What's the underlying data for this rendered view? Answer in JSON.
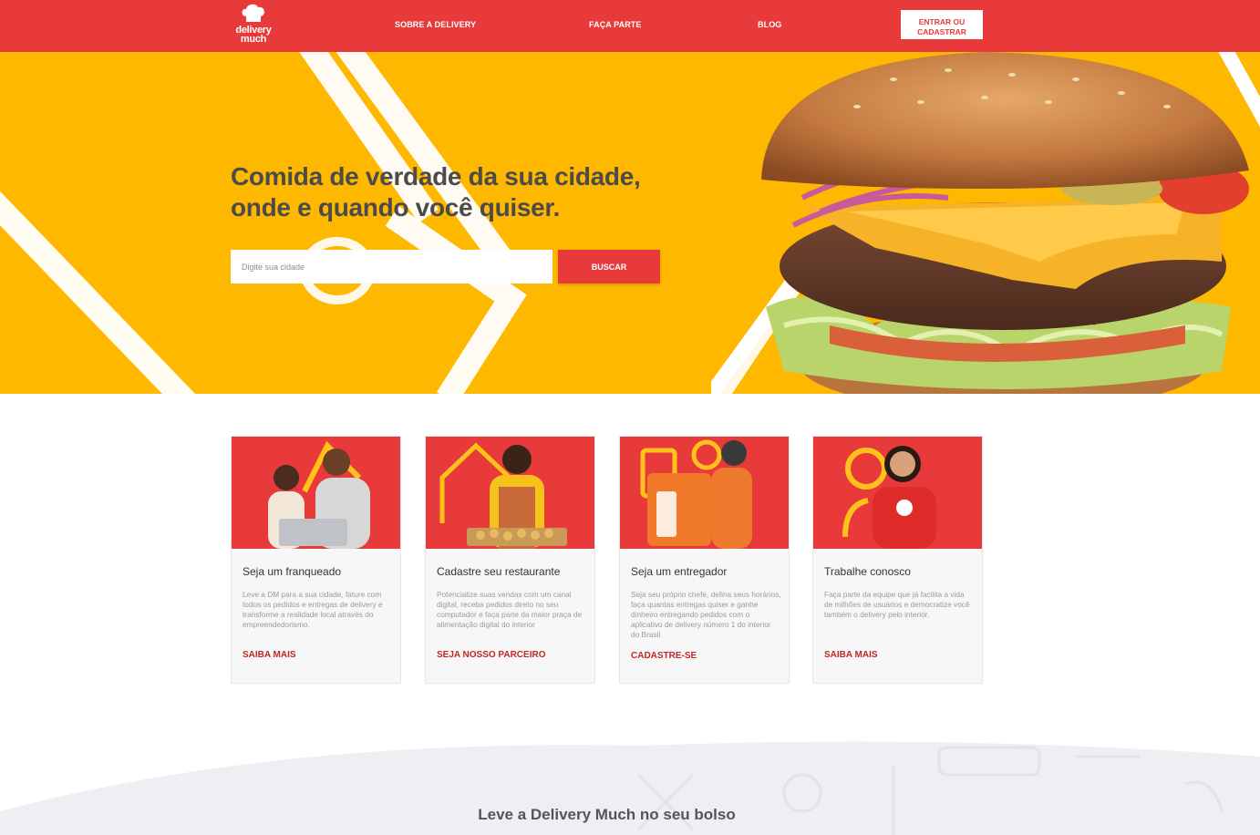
{
  "brand": {
    "logo_line1": "delivery",
    "logo_line2": "much"
  },
  "nav": {
    "links": [
      "SOBRE A DELIVERY",
      "FAÇA PARTE",
      "BLOG"
    ],
    "login_line1": "ENTRAR OU",
    "login_line2": "CADASTRAR"
  },
  "hero": {
    "headline_line1": "Comida de verdade da sua cidade,",
    "headline_line2": "onde e quando você quiser.",
    "search_placeholder": "Digite sua cidade",
    "search_button": "BUSCAR"
  },
  "cards": [
    {
      "title": "Seja um franqueado",
      "desc": "Leve a DM para a sua cidade, fature com todos os pedidos e entregas de delivery e transforme a realidade local através do empreendedorismo.",
      "link": "SAIBA MAIS"
    },
    {
      "title": "Cadastre seu restaurante",
      "desc": "Potencialize suas vendas com um canal digital, receba pedidos direto no seu computador e faça parte da maior praça de alimentação digital do interior",
      "link": "SEJA NOSSO PARCEIRO"
    },
    {
      "title": "Seja um entregador",
      "desc": "Seja seu próprio chefe, defina seus horários, faça quantas entregas quiser e ganhe dinheiro entregando pedidos com o aplicativo de delivery número 1 do interior do Brasil",
      "link": "CADASTRE-SE"
    },
    {
      "title": "Trabalhe conosco",
      "desc": "Faça parte da equipe que já facilita a vida de milhões de usuários e democratize você também o delivery pelo interior.",
      "link": "SAIBA MAIS"
    }
  ],
  "app_section": {
    "title": "Leve a Delivery Much no seu bolso"
  },
  "colors": {
    "brand_red": "#e83a3a",
    "hero_yellow": "#ffb800",
    "link_red": "#c0282a"
  }
}
